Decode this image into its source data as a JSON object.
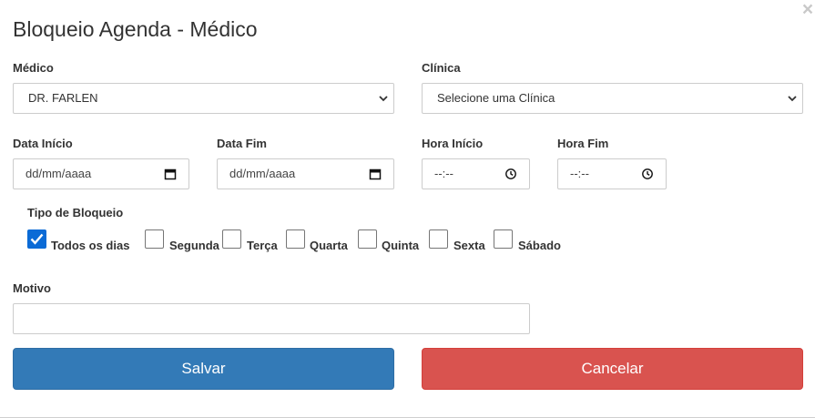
{
  "modal": {
    "title": "Bloqueio Agenda - Médico",
    "close_glyph": "×"
  },
  "medico": {
    "label": "Médico",
    "selected": "DR. FARLEN"
  },
  "clinica": {
    "label": "Clínica",
    "selected": "Selecione uma Clínica"
  },
  "data_inicio": {
    "label": "Data Início",
    "placeholder": "dd/mm/aaaa"
  },
  "data_fim": {
    "label": "Data Fim",
    "placeholder": "dd/mm/aaaa"
  },
  "hora_inicio": {
    "label": "Hora Início",
    "placeholder": "--:--"
  },
  "hora_fim": {
    "label": "Hora Fim",
    "placeholder": "--:--"
  },
  "tipo_bloqueio": {
    "label": "Tipo de Bloqueio",
    "options": [
      {
        "label": "Todos os dias",
        "checked": true
      },
      {
        "label": "Segunda",
        "checked": false
      },
      {
        "label": "Terça",
        "checked": false
      },
      {
        "label": "Quarta",
        "checked": false
      },
      {
        "label": "Quinta",
        "checked": false
      },
      {
        "label": "Sexta",
        "checked": false
      },
      {
        "label": "Sábado",
        "checked": false
      }
    ]
  },
  "motivo": {
    "label": "Motivo",
    "value": ""
  },
  "buttons": {
    "save_label": "Salvar",
    "cancel_label": "Cancelar"
  },
  "colors": {
    "save": "#337ab7",
    "cancel": "#d9534f",
    "checkbox_checked": "#0b6bd6"
  },
  "icons": {
    "close": "close-icon",
    "select": "chevron-down-icon",
    "date": "calendar-icon",
    "time": "clock-icon",
    "check": "check-icon"
  }
}
